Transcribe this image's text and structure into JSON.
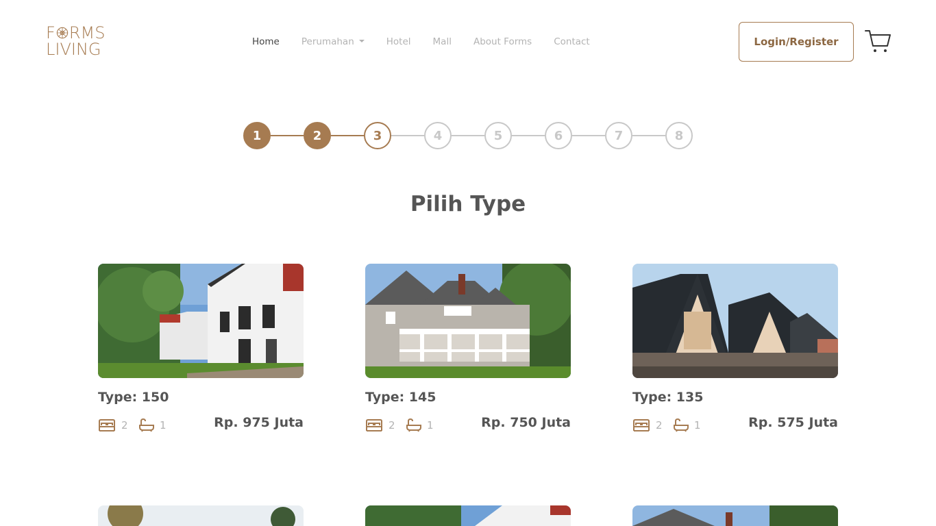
{
  "brand": {
    "logo_line1": "FORMS",
    "logo_line2": "LIVING",
    "color": "#a67b51"
  },
  "nav": {
    "items": [
      {
        "label": "Home",
        "active": true
      },
      {
        "label": "Perumahan",
        "dropdown": true
      },
      {
        "label": "Hotel"
      },
      {
        "label": "Mall"
      },
      {
        "label": "About Forms"
      },
      {
        "label": "Contact"
      }
    ]
  },
  "header": {
    "login_label": "Login/Register",
    "cart_icon": "cart-icon"
  },
  "stepper": {
    "steps": [
      "1",
      "2",
      "3",
      "4",
      "5",
      "6",
      "7",
      "8"
    ],
    "completed": 2,
    "current": 3
  },
  "page": {
    "title": "Pilih Type"
  },
  "cards": [
    {
      "type": "Type: 150",
      "beds": "2",
      "baths": "1",
      "price": "Rp. 975 Juta"
    },
    {
      "type": "Type: 145",
      "beds": "2",
      "baths": "1",
      "price": "Rp. 750 Juta"
    },
    {
      "type": "Type: 135",
      "beds": "2",
      "baths": "1",
      "price": "Rp. 575 Juta"
    }
  ],
  "colors": {
    "accent": "#a67b51",
    "inactive": "#c8c8c8",
    "text": "#555555",
    "muted": "#b3b3b3"
  }
}
